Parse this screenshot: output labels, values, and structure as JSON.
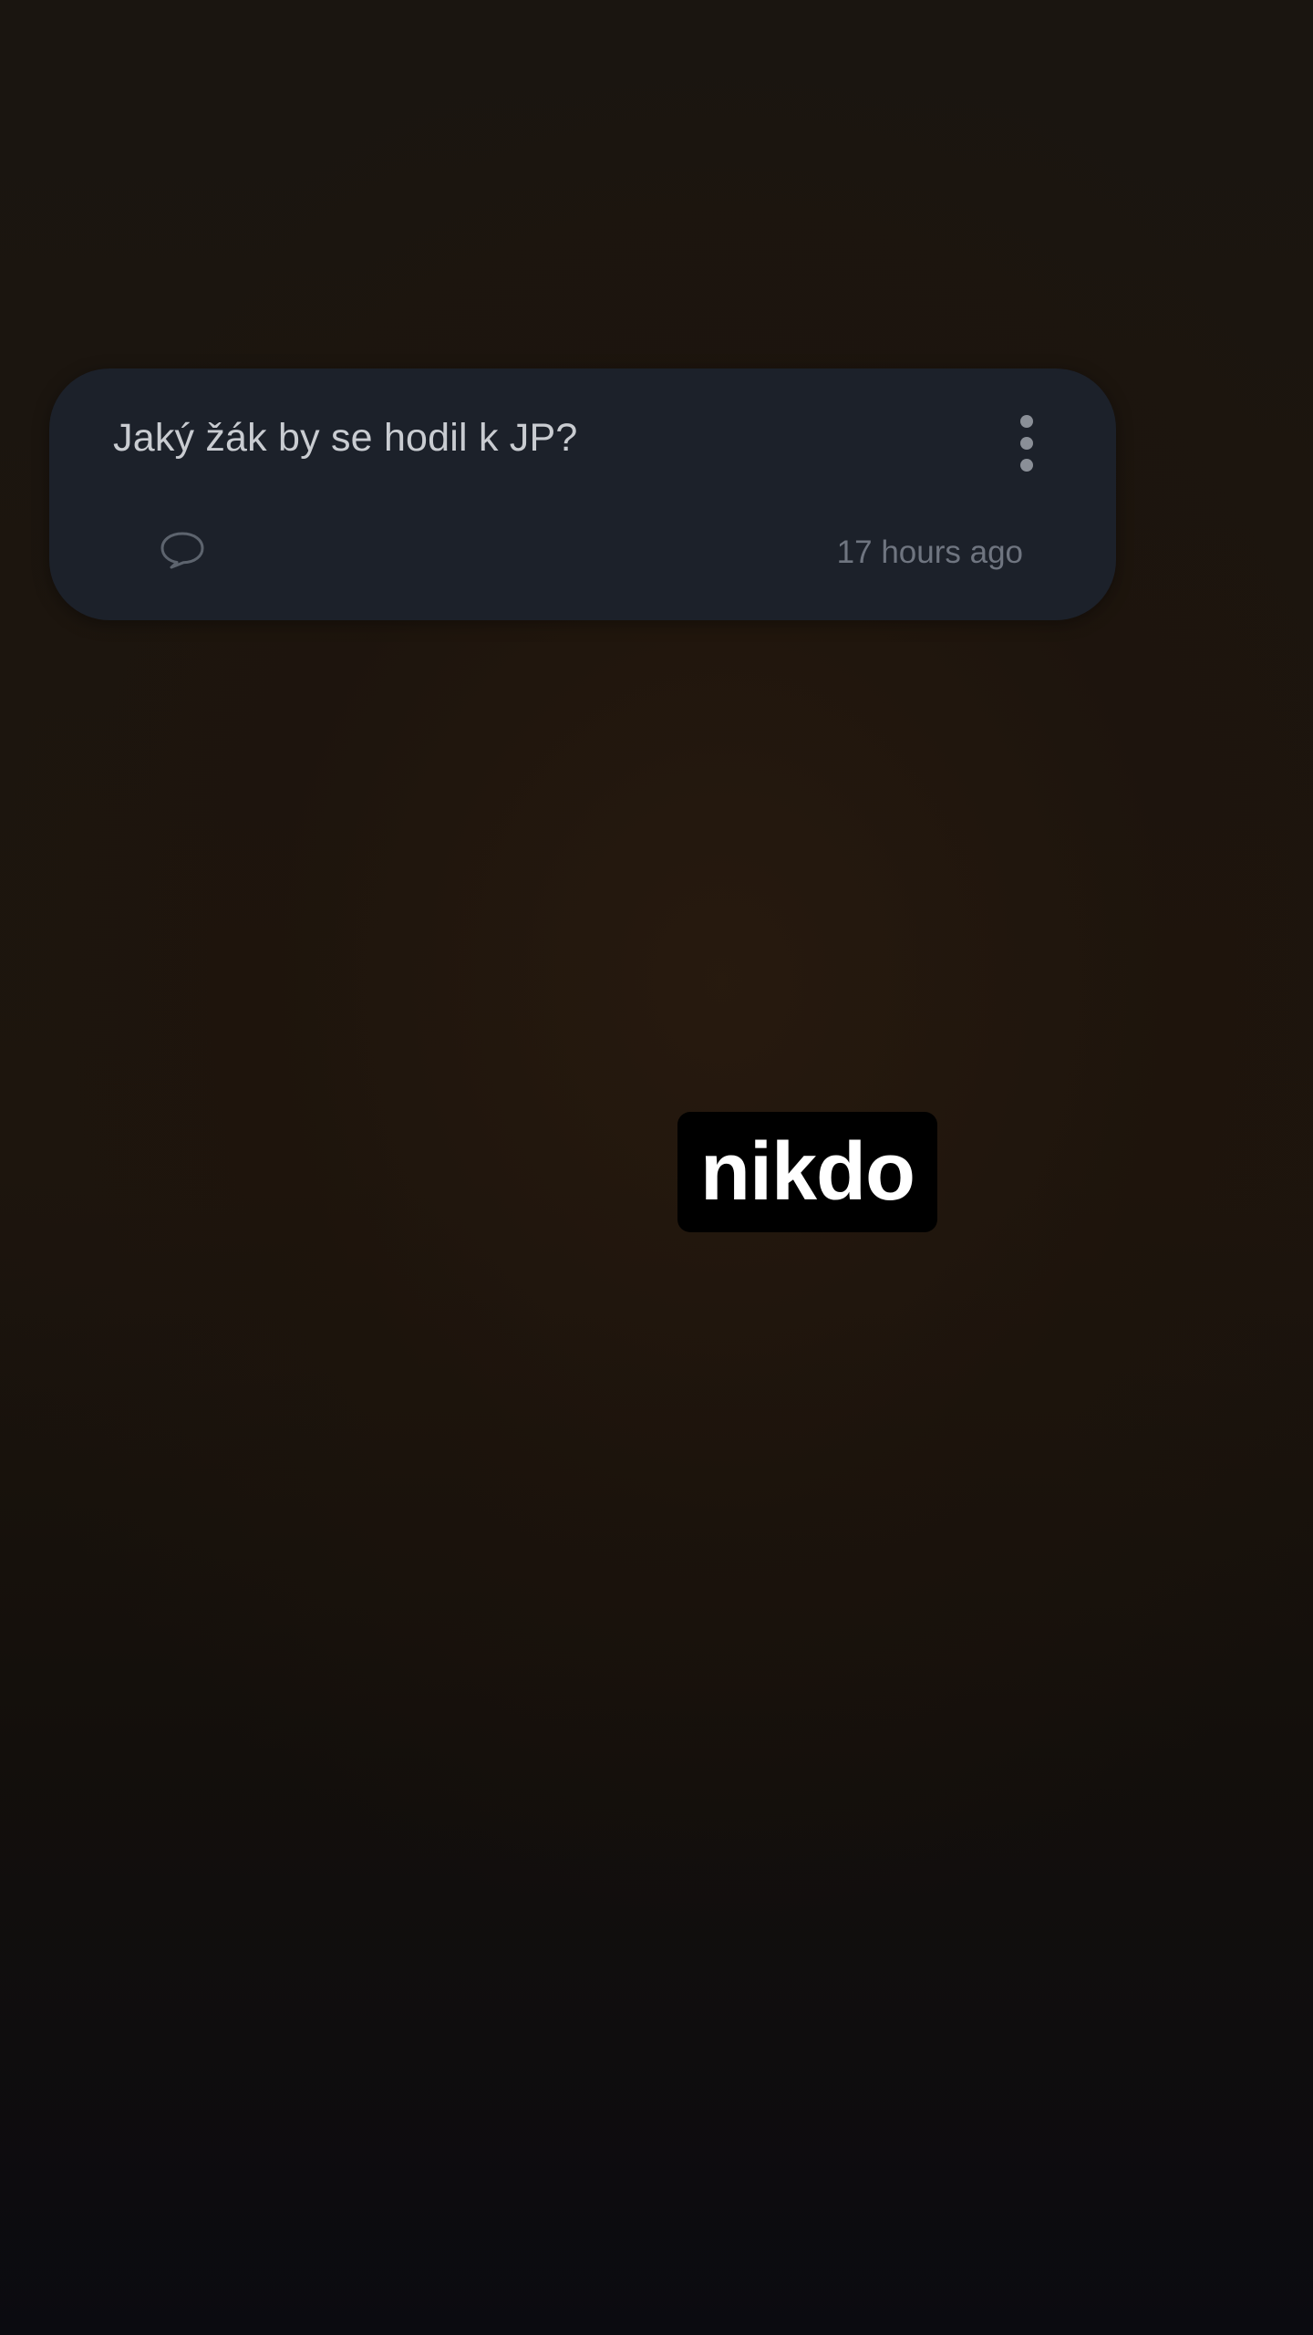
{
  "question_card": {
    "question": "Jaký žák by se hodil k JP?",
    "time_ago": "17 hours ago",
    "icons": {
      "more": "more-vertical-icon",
      "comment": "comment-bubble-icon"
    }
  },
  "reply": {
    "text": "nikdo"
  },
  "colors": {
    "card_background": "#1c212a",
    "question_text": "#c9ccd1",
    "secondary_text": "#6f7580",
    "reply_background": "#000000",
    "reply_text": "#ffffff"
  }
}
